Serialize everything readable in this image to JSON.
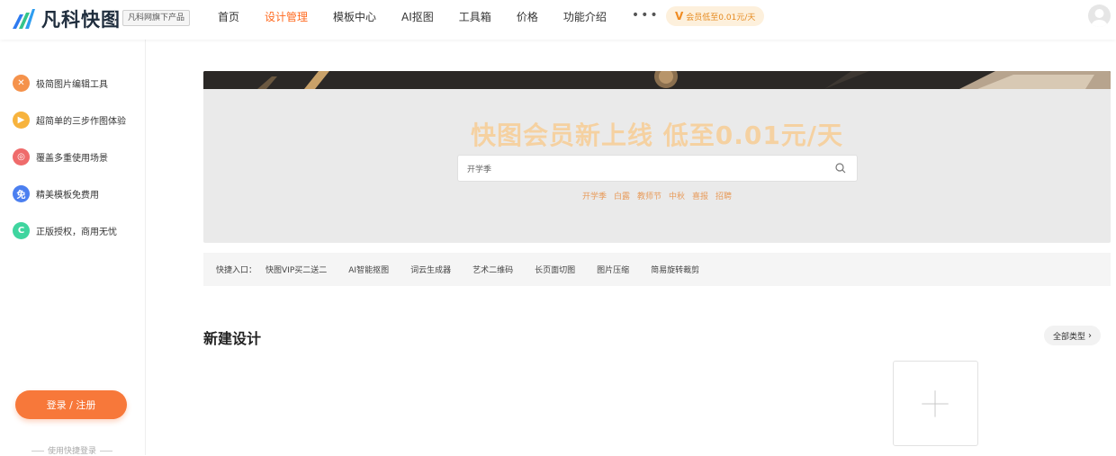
{
  "header": {
    "logo_text": "凡科快图",
    "brand_tag": "凡科网旗下产品",
    "nav": [
      {
        "label": "首页",
        "active": false
      },
      {
        "label": "设计管理",
        "active": true
      },
      {
        "label": "模板中心",
        "active": false
      },
      {
        "label": "AI抠图",
        "active": false
      },
      {
        "label": "工具箱",
        "active": false
      },
      {
        "label": "价格",
        "active": false
      },
      {
        "label": "功能介绍",
        "active": false
      }
    ],
    "more_label": "•••",
    "vip_badge": "会员低至0.01元/天",
    "accent_color": "#ff6a1f"
  },
  "sidebar": {
    "features": [
      {
        "label": "极简图片编辑工具",
        "icon": "x-mark-icon",
        "color": "#f5924b",
        "glyph": "✕"
      },
      {
        "label": "超简单的三步作图体验",
        "icon": "play-icon",
        "color": "#f7b33d",
        "glyph": "▶"
      },
      {
        "label": "覆盖多重使用场景",
        "icon": "layers-icon",
        "color": "#ef6b6b",
        "glyph": "◎"
      },
      {
        "label": "精美模板免费用",
        "icon": "free-icon",
        "color": "#4b7ff0",
        "glyph": "免"
      },
      {
        "label": "正版授权，商用无忧",
        "icon": "copyright-icon",
        "color": "#3fd59f",
        "glyph": "C"
      }
    ],
    "login_button": "登录 / 注册",
    "quick_login": "使用快捷登录"
  },
  "banner": {
    "title": "快图会员新上线 低至0.01元/天",
    "search": {
      "value": "开学季"
    },
    "hot_tags": [
      "开学季",
      "白露",
      "教师节",
      "中秋",
      "喜报",
      "招聘"
    ]
  },
  "shortcuts": {
    "label": "快捷入口：",
    "items": [
      "快图VIP买二送二",
      "AI智能抠图",
      "词云生成器",
      "艺术二维码",
      "长页面切图",
      "图片压缩",
      "简易旋转裁剪"
    ]
  },
  "new_design": {
    "title": "新建设计",
    "all_types": "全部类型"
  }
}
